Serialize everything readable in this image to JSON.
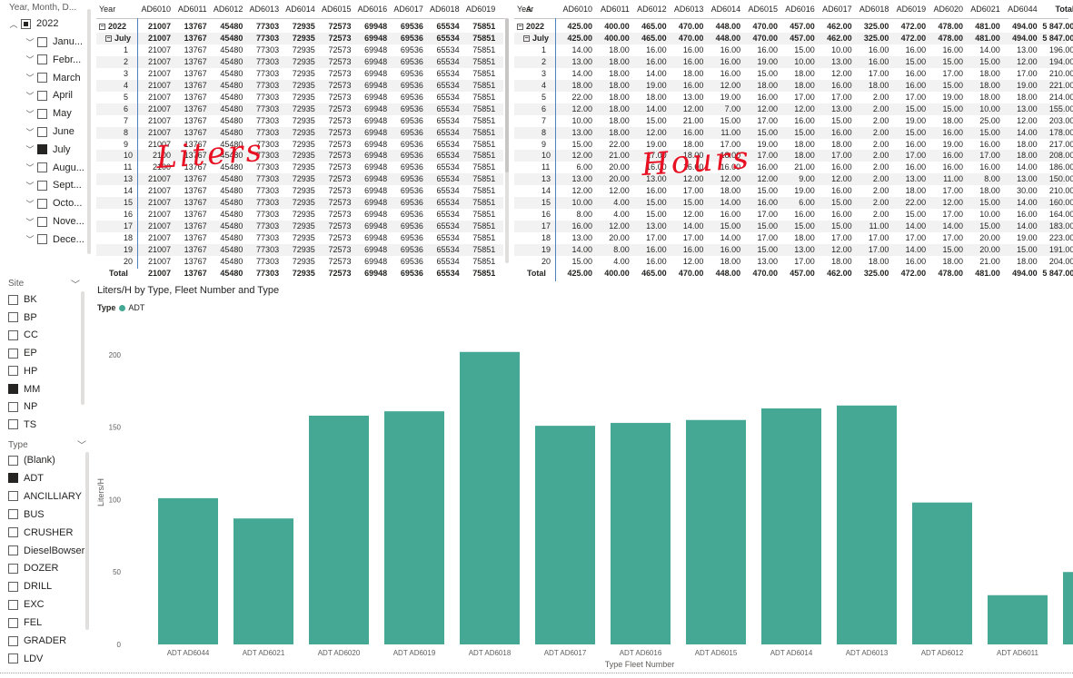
{
  "date_slicer": {
    "title": "Year, Month, D...",
    "year": "2022",
    "months": [
      {
        "label": "Janu...",
        "checked": false
      },
      {
        "label": "Febr...",
        "checked": false
      },
      {
        "label": "March",
        "checked": false
      },
      {
        "label": "April",
        "checked": false
      },
      {
        "label": "May",
        "checked": false
      },
      {
        "label": "June",
        "checked": false
      },
      {
        "label": "July",
        "checked": true
      },
      {
        "label": "Augu...",
        "checked": false
      },
      {
        "label": "Sept...",
        "checked": false
      },
      {
        "label": "Octo...",
        "checked": false
      },
      {
        "label": "Nove...",
        "checked": false
      },
      {
        "label": "Dece...",
        "checked": false
      }
    ]
  },
  "site_slicer": {
    "title": "Site",
    "items": [
      {
        "label": "BK",
        "checked": false
      },
      {
        "label": "BP",
        "checked": false
      },
      {
        "label": "CC",
        "checked": false
      },
      {
        "label": "EP",
        "checked": false
      },
      {
        "label": "HP",
        "checked": false
      },
      {
        "label": "MM",
        "checked": true
      },
      {
        "label": "NP",
        "checked": false
      },
      {
        "label": "TS",
        "checked": false
      }
    ]
  },
  "type_slicer": {
    "title": "Type",
    "items": [
      {
        "label": "(Blank)",
        "checked": false
      },
      {
        "label": "ADT",
        "checked": true
      },
      {
        "label": "ANCILLIARY",
        "checked": false
      },
      {
        "label": "BUS",
        "checked": false
      },
      {
        "label": "CRUSHER",
        "checked": false
      },
      {
        "label": "DieselBowser",
        "checked": false
      },
      {
        "label": "DOZER",
        "checked": false
      },
      {
        "label": "DRILL",
        "checked": false
      },
      {
        "label": "EXC",
        "checked": false
      },
      {
        "label": "FEL",
        "checked": false
      },
      {
        "label": "GRADER",
        "checked": false
      },
      {
        "label": "LDV",
        "checked": false
      }
    ]
  },
  "liters_matrix": {
    "corner": "Year",
    "columns": [
      "AD6010",
      "AD6011",
      "AD6012",
      "AD6013",
      "AD6014",
      "AD6015",
      "AD6016",
      "AD6017",
      "AD6018",
      "AD6019",
      "A"
    ],
    "rows": [
      {
        "label": "2022",
        "bold": true,
        "expander": "−",
        "values": [
          "21007",
          "13767",
          "45480",
          "77303",
          "72935",
          "72573",
          "69948",
          "69536",
          "65534",
          "75851"
        ]
      },
      {
        "label": "July",
        "bold": true,
        "expander": "−",
        "values": [
          "21007",
          "13767",
          "45480",
          "77303",
          "72935",
          "72573",
          "69948",
          "69536",
          "65534",
          "75851"
        ]
      },
      {
        "label": "1",
        "values": [
          "21007",
          "13767",
          "45480",
          "77303",
          "72935",
          "72573",
          "69948",
          "69536",
          "65534",
          "75851"
        ]
      },
      {
        "label": "2",
        "values": [
          "21007",
          "13767",
          "45480",
          "77303",
          "72935",
          "72573",
          "69948",
          "69536",
          "65534",
          "75851"
        ]
      },
      {
        "label": "3",
        "values": [
          "21007",
          "13767",
          "45480",
          "77303",
          "72935",
          "72573",
          "69948",
          "69536",
          "65534",
          "75851"
        ]
      },
      {
        "label": "4",
        "values": [
          "21007",
          "13767",
          "45480",
          "77303",
          "72935",
          "72573",
          "69948",
          "69536",
          "65534",
          "75851"
        ]
      },
      {
        "label": "5",
        "values": [
          "21007",
          "13767",
          "45480",
          "77303",
          "72935",
          "72573",
          "69948",
          "69536",
          "65534",
          "75851"
        ]
      },
      {
        "label": "6",
        "values": [
          "21007",
          "13767",
          "45480",
          "77303",
          "72935",
          "72573",
          "69948",
          "69536",
          "65534",
          "75851"
        ]
      },
      {
        "label": "7",
        "values": [
          "21007",
          "13767",
          "45480",
          "77303",
          "72935",
          "72573",
          "69948",
          "69536",
          "65534",
          "75851"
        ]
      },
      {
        "label": "8",
        "values": [
          "21007",
          "13767",
          "45480",
          "77303",
          "72935",
          "72573",
          "69948",
          "69536",
          "65534",
          "75851"
        ]
      },
      {
        "label": "9",
        "values": [
          "21007",
          "13767",
          "45480",
          "77303",
          "72935",
          "72573",
          "69948",
          "69536",
          "65534",
          "75851"
        ]
      },
      {
        "label": "10",
        "values": [
          "2100",
          "13767",
          "45480",
          "77303",
          "72935",
          "72573",
          "69948",
          "69536",
          "65534",
          "75851"
        ]
      },
      {
        "label": "11",
        "values": [
          "2100",
          "13767",
          "45480",
          "77303",
          "72935",
          "72573",
          "69948",
          "69536",
          "65534",
          "75851"
        ]
      },
      {
        "label": "13",
        "values": [
          "21007",
          "13767",
          "45480",
          "77303",
          "72935",
          "72573",
          "69948",
          "69536",
          "65534",
          "75851"
        ]
      },
      {
        "label": "14",
        "values": [
          "21007",
          "13767",
          "45480",
          "77303",
          "72935",
          "72573",
          "69948",
          "69536",
          "65534",
          "75851"
        ]
      },
      {
        "label": "15",
        "values": [
          "21007",
          "13767",
          "45480",
          "77303",
          "72935",
          "72573",
          "69948",
          "69536",
          "65534",
          "75851"
        ]
      },
      {
        "label": "16",
        "values": [
          "21007",
          "13767",
          "45480",
          "77303",
          "72935",
          "72573",
          "69948",
          "69536",
          "65534",
          "75851"
        ]
      },
      {
        "label": "17",
        "values": [
          "21007",
          "13767",
          "45480",
          "77303",
          "72935",
          "72573",
          "69948",
          "69536",
          "65534",
          "75851"
        ]
      },
      {
        "label": "18",
        "values": [
          "21007",
          "13767",
          "45480",
          "77303",
          "72935",
          "72573",
          "69948",
          "69536",
          "65534",
          "75851"
        ]
      },
      {
        "label": "19",
        "values": [
          "21007",
          "13767",
          "45480",
          "77303",
          "72935",
          "72573",
          "69948",
          "69536",
          "65534",
          "75851"
        ]
      },
      {
        "label": "20",
        "values": [
          "21007",
          "13767",
          "45480",
          "77303",
          "72935",
          "72573",
          "69948",
          "69536",
          "65534",
          "75851"
        ]
      }
    ],
    "total": {
      "label": "Total",
      "values": [
        "21007",
        "13767",
        "45480",
        "77303",
        "72935",
        "72573",
        "69948",
        "69536",
        "65534",
        "75851"
      ]
    },
    "annotation": "Liters"
  },
  "hours_matrix": {
    "corner": "Year",
    "columns": [
      "AD6010",
      "AD6011",
      "AD6012",
      "AD6013",
      "AD6014",
      "AD6015",
      "AD6016",
      "AD6017",
      "AD6018",
      "AD6019",
      "AD6020",
      "AD6021",
      "AD6044",
      "Total"
    ],
    "rows": [
      {
        "label": "2022",
        "bold": true,
        "expander": "−",
        "values": [
          "425.00",
          "400.00",
          "465.00",
          "470.00",
          "448.00",
          "470.00",
          "457.00",
          "462.00",
          "325.00",
          "472.00",
          "478.00",
          "481.00",
          "494.00",
          "5 847.00"
        ]
      },
      {
        "label": "July",
        "bold": true,
        "expander": "−",
        "values": [
          "425.00",
          "400.00",
          "465.00",
          "470.00",
          "448.00",
          "470.00",
          "457.00",
          "462.00",
          "325.00",
          "472.00",
          "478.00",
          "481.00",
          "494.00",
          "5 847.00"
        ]
      },
      {
        "label": "1",
        "values": [
          "14.00",
          "18.00",
          "16.00",
          "16.00",
          "16.00",
          "16.00",
          "15.00",
          "10.00",
          "16.00",
          "16.00",
          "16.00",
          "14.00",
          "13.00",
          "196.00"
        ]
      },
      {
        "label": "2",
        "values": [
          "13.00",
          "18.00",
          "16.00",
          "16.00",
          "16.00",
          "19.00",
          "10.00",
          "13.00",
          "16.00",
          "15.00",
          "15.00",
          "15.00",
          "12.00",
          "194.00"
        ]
      },
      {
        "label": "3",
        "values": [
          "14.00",
          "18.00",
          "14.00",
          "18.00",
          "16.00",
          "15.00",
          "18.00",
          "12.00",
          "17.00",
          "16.00",
          "17.00",
          "18.00",
          "17.00",
          "210.00"
        ]
      },
      {
        "label": "4",
        "values": [
          "18.00",
          "18.00",
          "19.00",
          "16.00",
          "12.00",
          "18.00",
          "18.00",
          "16.00",
          "18.00",
          "16.00",
          "15.00",
          "18.00",
          "19.00",
          "221.00"
        ]
      },
      {
        "label": "5",
        "values": [
          "22.00",
          "18.00",
          "18.00",
          "13.00",
          "19.00",
          "16.00",
          "17.00",
          "17.00",
          "2.00",
          "17.00",
          "19.00",
          "18.00",
          "18.00",
          "214.00"
        ]
      },
      {
        "label": "6",
        "values": [
          "12.00",
          "18.00",
          "14.00",
          "12.00",
          "7.00",
          "12.00",
          "12.00",
          "13.00",
          "2.00",
          "15.00",
          "15.00",
          "10.00",
          "13.00",
          "155.00"
        ]
      },
      {
        "label": "7",
        "values": [
          "10.00",
          "18.00",
          "15.00",
          "21.00",
          "15.00",
          "17.00",
          "16.00",
          "15.00",
          "2.00",
          "19.00",
          "18.00",
          "25.00",
          "12.00",
          "203.00"
        ]
      },
      {
        "label": "8",
        "values": [
          "13.00",
          "18.00",
          "12.00",
          "16.00",
          "11.00",
          "15.00",
          "15.00",
          "16.00",
          "2.00",
          "15.00",
          "16.00",
          "15.00",
          "14.00",
          "178.00"
        ]
      },
      {
        "label": "9",
        "values": [
          "15.00",
          "22.00",
          "19.00",
          "18.00",
          "17.00",
          "19.00",
          "18.00",
          "18.00",
          "2.00",
          "16.00",
          "19.00",
          "16.00",
          "18.00",
          "217.00"
        ]
      },
      {
        "label": "10",
        "values": [
          "12.00",
          "21.00",
          "17.00",
          "18.00",
          "18.00",
          "17.00",
          "18.00",
          "17.00",
          "2.00",
          "17.00",
          "16.00",
          "17.00",
          "18.00",
          "208.00"
        ]
      },
      {
        "label": "11",
        "values": [
          "6.00",
          "20.00",
          "16.00",
          "16.00",
          "16.00",
          "16.00",
          "21.00",
          "16.00",
          "2.00",
          "16.00",
          "16.00",
          "16.00",
          "14.00",
          "186.00"
        ]
      },
      {
        "label": "13",
        "values": [
          "13.00",
          "20.00",
          "13.00",
          "12.00",
          "12.00",
          "12.00",
          "9.00",
          "12.00",
          "2.00",
          "13.00",
          "11.00",
          "8.00",
          "13.00",
          "150.00"
        ]
      },
      {
        "label": "14",
        "values": [
          "12.00",
          "12.00",
          "16.00",
          "17.00",
          "18.00",
          "15.00",
          "19.00",
          "16.00",
          "2.00",
          "18.00",
          "17.00",
          "18.00",
          "30.00",
          "210.00"
        ]
      },
      {
        "label": "15",
        "values": [
          "10.00",
          "4.00",
          "15.00",
          "15.00",
          "14.00",
          "16.00",
          "6.00",
          "15.00",
          "2.00",
          "22.00",
          "12.00",
          "15.00",
          "14.00",
          "160.00"
        ]
      },
      {
        "label": "16",
        "values": [
          "8.00",
          "4.00",
          "15.00",
          "12.00",
          "16.00",
          "17.00",
          "16.00",
          "16.00",
          "2.00",
          "15.00",
          "17.00",
          "10.00",
          "16.00",
          "164.00"
        ]
      },
      {
        "label": "17",
        "values": [
          "16.00",
          "12.00",
          "13.00",
          "14.00",
          "15.00",
          "15.00",
          "15.00",
          "15.00",
          "11.00",
          "14.00",
          "14.00",
          "15.00",
          "14.00",
          "183.00"
        ]
      },
      {
        "label": "18",
        "values": [
          "13.00",
          "20.00",
          "17.00",
          "17.00",
          "14.00",
          "17.00",
          "18.00",
          "17.00",
          "17.00",
          "17.00",
          "17.00",
          "20.00",
          "19.00",
          "223.00"
        ]
      },
      {
        "label": "19",
        "values": [
          "14.00",
          "8.00",
          "16.00",
          "16.00",
          "16.00",
          "15.00",
          "13.00",
          "12.00",
          "17.00",
          "14.00",
          "15.00",
          "20.00",
          "15.00",
          "191.00"
        ]
      },
      {
        "label": "20",
        "values": [
          "15.00",
          "4.00",
          "16.00",
          "12.00",
          "18.00",
          "13.00",
          "17.00",
          "18.00",
          "18.00",
          "16.00",
          "18.00",
          "21.00",
          "18.00",
          "204.00"
        ]
      }
    ],
    "total": {
      "label": "Total",
      "values": [
        "425.00",
        "400.00",
        "465.00",
        "470.00",
        "448.00",
        "470.00",
        "457.00",
        "462.00",
        "325.00",
        "472.00",
        "478.00",
        "481.00",
        "494.00",
        "5 847.00"
      ]
    },
    "annotation": "Hours"
  },
  "chart_data": {
    "type": "bar",
    "title": "Liters/H by Type, Fleet Number and Type",
    "legend_title": "Type",
    "legend_position": "top-left",
    "ylabel": "Liters/H",
    "xlabel": "Type Fleet Number",
    "ylim": [
      0,
      210
    ],
    "yticks": [
      0,
      50,
      100,
      150,
      200
    ],
    "grid": false,
    "categories": [
      "ADT AD6044",
      "ADT AD6021",
      "ADT AD6020",
      "ADT AD6019",
      "ADT AD6018",
      "ADT AD6017",
      "ADT AD6016",
      "ADT AD6015",
      "ADT AD6014",
      "ADT AD6013",
      "ADT AD6012",
      "ADT AD6011",
      "A"
    ],
    "series": [
      {
        "name": "ADT",
        "color": "#44a894",
        "values": [
          101,
          87,
          158,
          161,
          202,
          151,
          153,
          155,
          163,
          165,
          98,
          34,
          50
        ]
      }
    ]
  },
  "colors": {
    "accent": "#44a894",
    "header_line": "#4f81bd",
    "annotation": "#e81123"
  }
}
